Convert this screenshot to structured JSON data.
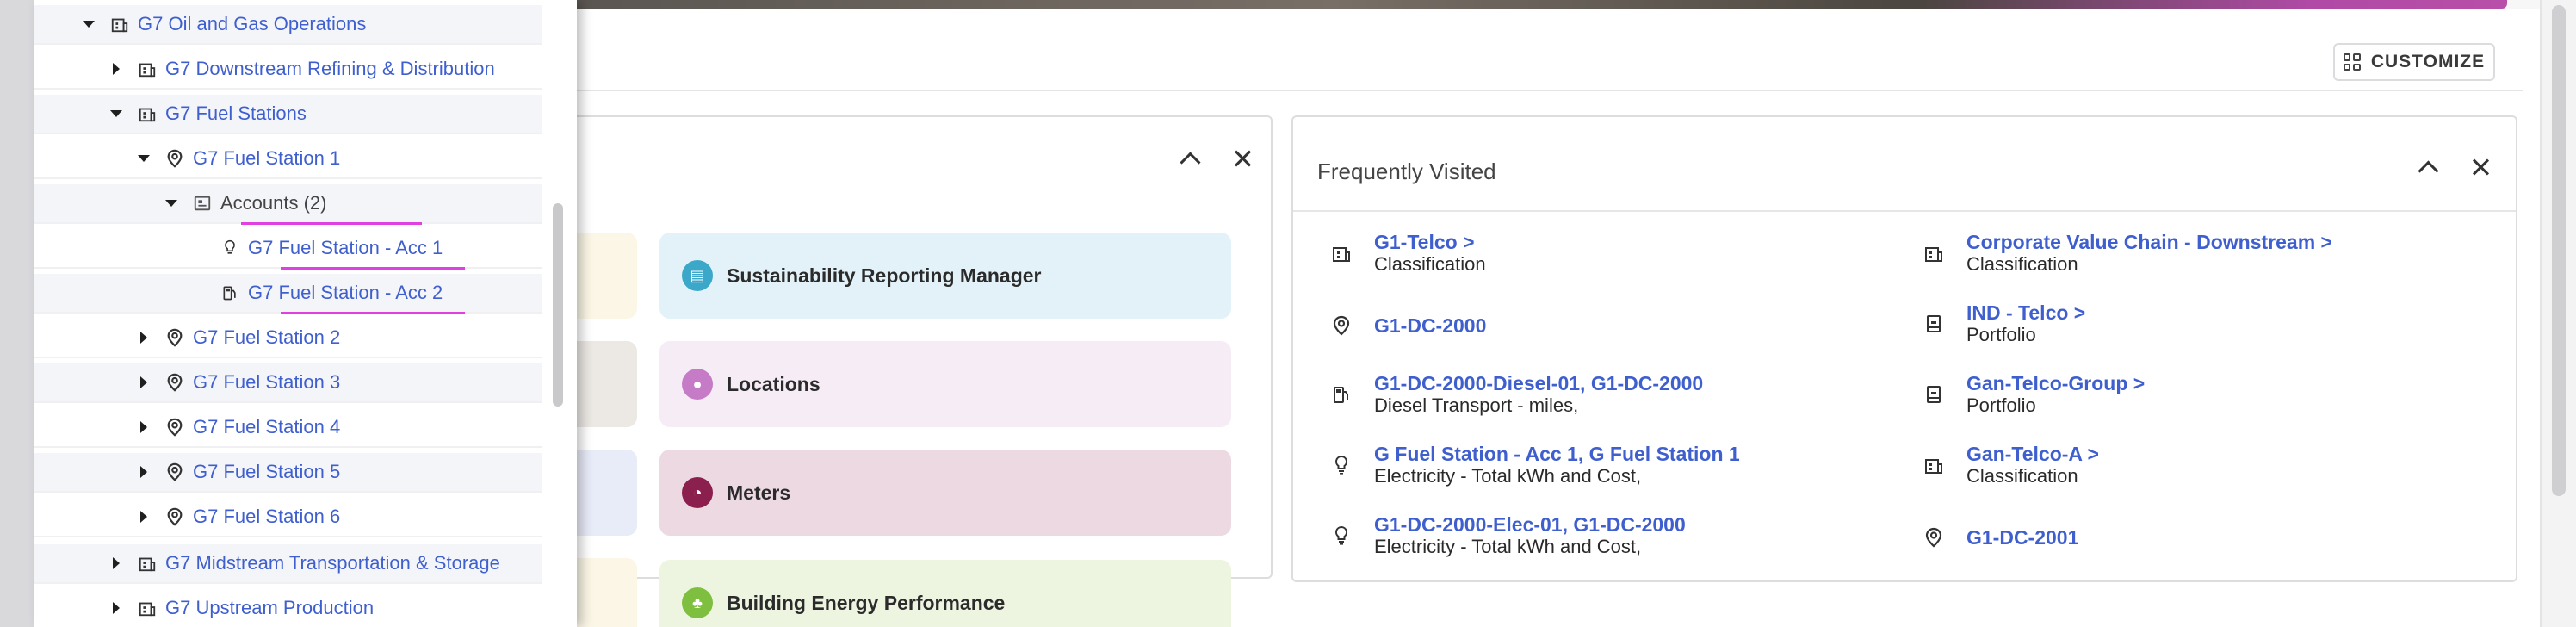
{
  "toolbar": {
    "customize_label": "CUSTOMIZE"
  },
  "quick_access": {
    "tiles": [
      {
        "label": "Sustainability Reporting Manager",
        "icon": "report-icon",
        "bg": "#e3f2f8",
        "icon_color": "#3ba7c9"
      },
      {
        "label": "Locations",
        "icon": "location-pin-icon",
        "bg": "#f6ecf6",
        "icon_color": "#c67bc6"
      },
      {
        "label": "Meters",
        "icon": "gauge-icon",
        "bg": "#ecd9e2",
        "icon_color": "#8b1f4e"
      },
      {
        "label": "Building Energy Performance",
        "icon": "building-leaf-icon",
        "bg": "#edf5e1",
        "icon_color": "#7fbf3f"
      }
    ]
  },
  "frequently_visited": {
    "title": "Frequently Visited",
    "left": [
      {
        "link": "G1-Telco >",
        "sub": "Classification",
        "icon": "building-icon"
      },
      {
        "link": "G1-DC-2000",
        "sub": "",
        "icon": "location-pin-icon"
      },
      {
        "link": "G1-DC-2000-Diesel-01, G1-DC-2000",
        "sub": "Diesel Transport - miles,",
        "icon": "fuel-meter-icon"
      },
      {
        "link": "G Fuel Station - Acc 1, G Fuel Station 1",
        "sub": "Electricity - Total kWh and Cost,",
        "icon": "lightbulb-icon"
      },
      {
        "link": "G1-DC-2000-Elec-01, G1-DC-2000",
        "sub": "Electricity - Total kWh and Cost,",
        "icon": "lightbulb-icon"
      }
    ],
    "right": [
      {
        "link": "Corporate Value Chain - Downstream >",
        "sub": "Classification",
        "icon": "building-icon"
      },
      {
        "link": "IND - Telco >",
        "sub": "Portfolio",
        "icon": "portfolio-icon"
      },
      {
        "link": "Gan-Telco-Group >",
        "sub": "Portfolio",
        "icon": "portfolio-icon"
      },
      {
        "link": "Gan-Telco-A >",
        "sub": "Classification",
        "icon": "building-icon"
      },
      {
        "link": "G1-DC-2001",
        "sub": "",
        "icon": "location-pin-icon"
      }
    ]
  },
  "tree": {
    "nodes": [
      {
        "label": "G7 Oil and Gas Operations",
        "caret": "down",
        "icon": "building-icon"
      },
      {
        "label": "G7 Downstream Refining & Distribution",
        "caret": "right",
        "icon": "building-icon"
      },
      {
        "label": "G7 Fuel Stations",
        "caret": "down",
        "icon": "building-icon"
      },
      {
        "label": "G7 Fuel Station 1",
        "caret": "down",
        "icon": "location-pin-icon"
      },
      {
        "label": "Accounts (2)",
        "caret": "down",
        "icon": "accounts-icon"
      },
      {
        "label": "G7 Fuel Station - Acc 1",
        "caret": "none",
        "icon": "lightbulb-icon"
      },
      {
        "label": "G7 Fuel Station - Acc 2",
        "caret": "none",
        "icon": "fuel-meter-icon"
      },
      {
        "label": "G7 Fuel Station 2",
        "caret": "right",
        "icon": "location-pin-icon"
      },
      {
        "label": "G7 Fuel Station 3",
        "caret": "right",
        "icon": "location-pin-icon"
      },
      {
        "label": "G7 Fuel Station 4",
        "caret": "right",
        "icon": "location-pin-icon"
      },
      {
        "label": "G7 Fuel Station 5",
        "caret": "right",
        "icon": "location-pin-icon"
      },
      {
        "label": "G7 Fuel Station 6",
        "caret": "right",
        "icon": "location-pin-icon"
      },
      {
        "label": "G7 Midstream Transportation & Storage",
        "caret": "right",
        "icon": "building-icon"
      },
      {
        "label": "G7 Upstream Production",
        "caret": "right",
        "icon": "building-icon"
      }
    ]
  },
  "colors": {
    "link": "#3f5fcf",
    "highlight": "#e040e0"
  }
}
